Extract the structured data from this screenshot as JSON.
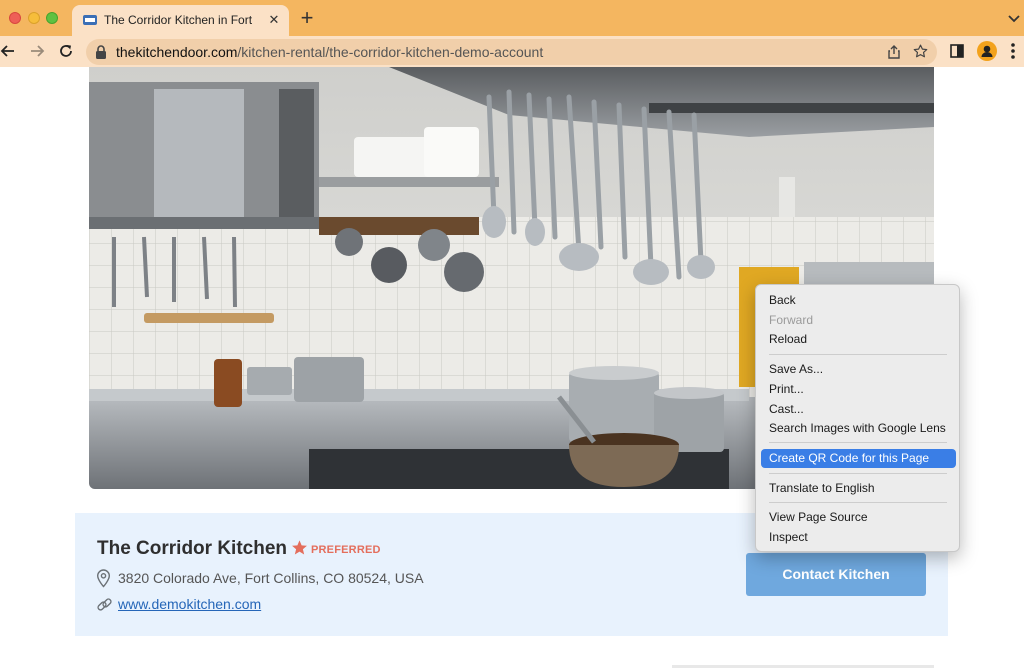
{
  "browser": {
    "tab": {
      "title": "The Corridor Kitchen in Fort Co"
    },
    "address_bar": {
      "host": "thekitchendoor.com",
      "path": "/kitchen-rental/the-corridor-kitchen-demo-account"
    },
    "icons": [
      "back-icon",
      "forward-icon",
      "reload-icon",
      "lock-icon",
      "share-icon",
      "bookmark-star-icon",
      "side-panel-icon",
      "profile-icon",
      "menu-icon"
    ]
  },
  "listing": {
    "name": "The Corridor Kitchen",
    "badge": "PREFERRED",
    "address": "3820 Colorado Ave, Fort Collins, CO 80524, USA",
    "website": "www.demokitchen.com",
    "contact_label": "Contact Kitchen"
  },
  "context_menu": {
    "items": [
      {
        "label": "Back",
        "enabled": true
      },
      {
        "label": "Forward",
        "enabled": false
      },
      {
        "label": "Reload",
        "enabled": true
      },
      {
        "label": "Save As...",
        "enabled": true
      },
      {
        "label": "Print...",
        "enabled": true
      },
      {
        "label": "Cast...",
        "enabled": true
      },
      {
        "label": "Search Images with Google Lens",
        "enabled": true
      },
      {
        "label": "Create QR Code for this Page",
        "enabled": true,
        "highlighted": true
      },
      {
        "label": "Translate to English",
        "enabled": true
      },
      {
        "label": "View Page Source",
        "enabled": true
      },
      {
        "label": "Inspect",
        "enabled": true
      }
    ]
  },
  "colors": {
    "titlebar": "#f4b660",
    "toolbar": "#fbe1c6",
    "card_background": "#e8f2fd",
    "button": "#6fa8de",
    "preferred": "#e46e5c",
    "link": "#2566b8",
    "menu_highlight": "#3a7ee6"
  }
}
